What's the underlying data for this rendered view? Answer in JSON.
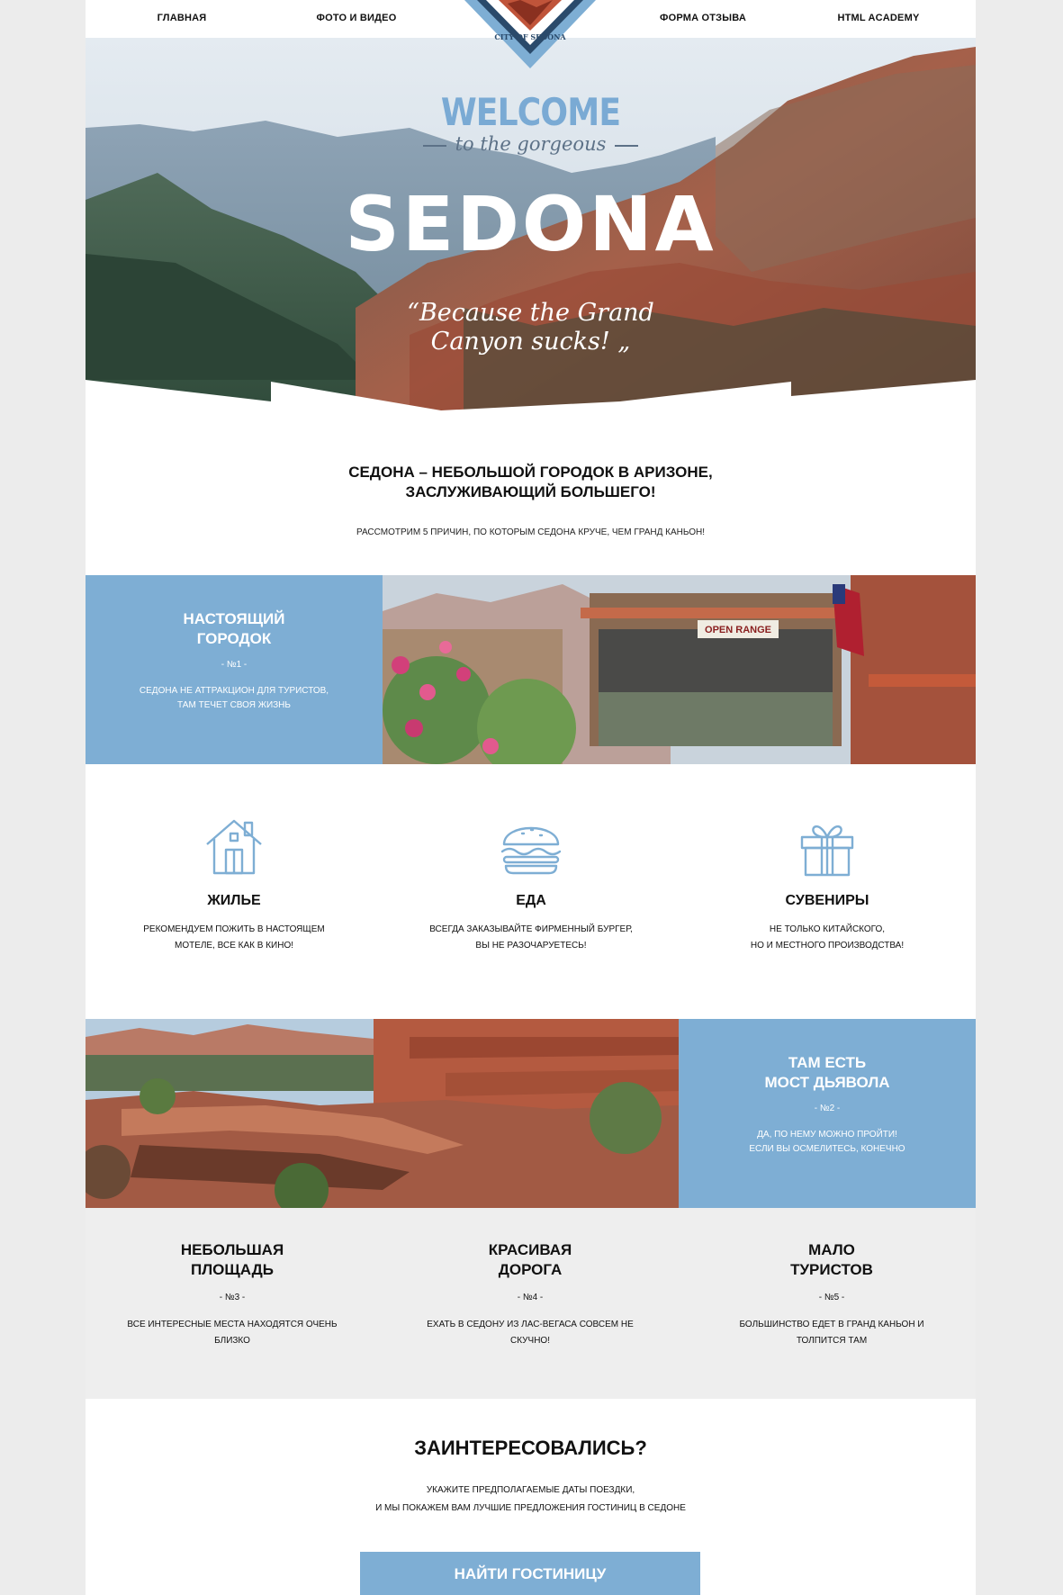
{
  "nav": {
    "items": [
      {
        "label": "Главная"
      },
      {
        "label": "Фото и видео"
      },
      {
        "label": "Форма отзыва"
      },
      {
        "label": "HTML Academy"
      }
    ],
    "logo_text": "CITY OF SEDONA"
  },
  "hero": {
    "welcome": "WELCOME",
    "subtitle": "to the gorgeous",
    "title": "SEDONA",
    "quote_line1": "“Because the Grand",
    "quote_line2": "Canyon sucks! „"
  },
  "intro": {
    "title_line1": "Седона – небольшой городок в Аризоне,",
    "title_line2": "заслуживающий большего!",
    "subtitle": "Рассмотрим 5 причин, по которым Седона круче, чем Гранд Каньон!"
  },
  "feature1": {
    "title_line1": "Настоящий",
    "title_line2": "городок",
    "number": "- №1 -",
    "text_line1": "Седона не аттракцион для туристов,",
    "text_line2": "там течет своя жизнь",
    "sign_text": "OPEN RANGE"
  },
  "icons": [
    {
      "icon": "house-icon",
      "title": "Жилье",
      "text_line1": "Рекомендуем пожить в настоящем",
      "text_line2": "мотеле, все как в кино!"
    },
    {
      "icon": "burger-icon",
      "title": "Еда",
      "text_line1": "Всегда заказывайте фирменный бургер,",
      "text_line2": "вы не разочаруетесь!"
    },
    {
      "icon": "gift-icon",
      "title": "Сувениры",
      "text_line1": "Не только китайского,",
      "text_line2": "но и местного производства!"
    }
  ],
  "feature2": {
    "title_line1": "Там есть",
    "title_line2": "мост дьявола",
    "number": "- №2 -",
    "text_line1": "Да, по нему можно пройти!",
    "text_line2": "Если вы осмелитесь, конечно"
  },
  "reasons": [
    {
      "title_line1": "Небольшая",
      "title_line2": "площадь",
      "number": "- №3 -",
      "text_line1": "Все интересные места находятся очень",
      "text_line2": "близко"
    },
    {
      "title_line1": "Красивая",
      "title_line2": "дорога",
      "number": "- №4 -",
      "text_line1": "Ехать в Седону из Лас-Вегаса совсем не",
      "text_line2": "скучно!"
    },
    {
      "title_line1": "Мало",
      "title_line2": "туристов",
      "number": "- №5 -",
      "text_line1": "Большинство едет в Гранд Каньон и",
      "text_line2": "толпится там"
    }
  ],
  "cta": {
    "title": "Заинтересовались?",
    "text_line1": "Укажите предполагаемые даты поездки,",
    "text_line2": "и мы покажем вам лучшие предложения гостиниц в Седоне",
    "button_label": "Найти гостиницу"
  },
  "colors": {
    "accent": "#7eaed4",
    "page_background": "#ececec",
    "grey_section": "#eeeeee",
    "text": "#111111"
  }
}
